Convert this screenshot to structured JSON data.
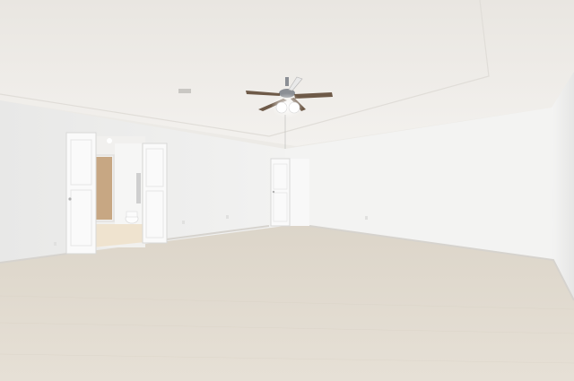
{
  "scene": {
    "subject": "empty-room-photo",
    "colors": {
      "ceiling": "#f1efec",
      "ceiling_shadow": "#e3e0db",
      "wall_left": "#eeeeed",
      "wall_back": "#f3f3f2",
      "wall_right": "#efefee",
      "carpet": "#e2dcd2",
      "carpet_far": "#ddd6ca",
      "door": "#fafafa",
      "door_frame": "#e9e9e8",
      "bath_tile": "#efe3cf",
      "closet_wood": "#c7a783",
      "fan_blade": "#6e5a48",
      "fan_metal": "#8b8f95",
      "light_glow": "#ffffff",
      "trim": "#d9d7d3"
    }
  }
}
